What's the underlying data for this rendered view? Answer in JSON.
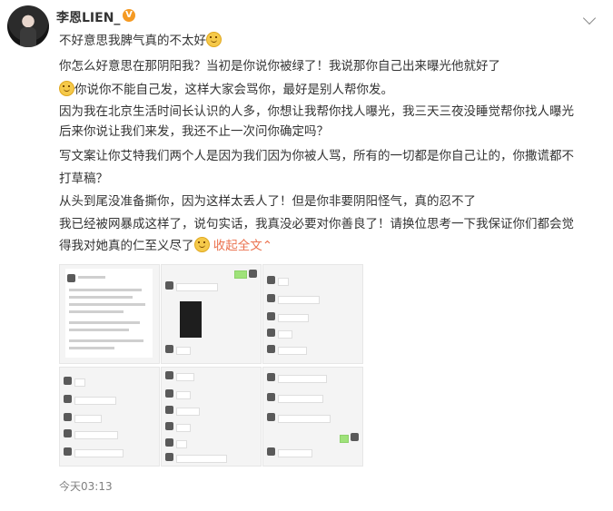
{
  "post": {
    "username": "李恩LIEN_",
    "badge_icon": "v-verified-badge-icon",
    "badge_color": "#f59a23",
    "more_icon": "chevron-down-icon",
    "lines": [
      {
        "text": "不好意思我脾气真的不太好",
        "emoji_after": true
      },
      {
        "text": "你怎么好意思在那阴阳我？当初是你说你被绿了！我说那你自己出来曝光他就好了"
      },
      {
        "text": "你说你不能自己发，这样大家会骂你，最好是别人帮你发。",
        "emoji_before": true
      },
      {
        "text": "因为我在北京生活时间长认识的人多，你想让我帮你找人曝光，我三天三夜没睡觉帮你找人曝光"
      },
      {
        "text": "后来你说让我们来发，我还不止一次问你确定吗？"
      },
      {
        "text": "写文案让你艾特我们两个人是因为我们因为你被人骂，所有的一切都是你自己让的，你撒谎都不"
      },
      {
        "text": "打草稿？"
      },
      {
        "text": "从头到尾没准备撕你，因为这样太丢人了！但是你非要阴阳怪气，真的忍不了"
      },
      {
        "text": "我已经被网暴成这样了，说句实话，我真没必要对你善良了！请换位思考一下我保证你们都会觉"
      },
      {
        "text": "得我对她真的仁至义尽了",
        "emoji_after": true,
        "collapse_label": "收起全文",
        "collapse_icon": "chevron-up-icon"
      }
    ],
    "accent_color": "#eb7350",
    "timestamp": "今天03:13"
  }
}
